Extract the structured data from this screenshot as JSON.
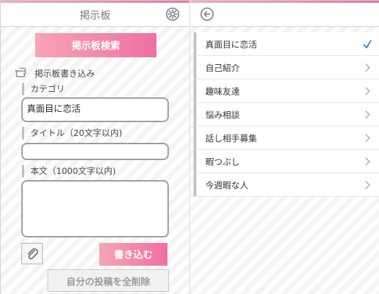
{
  "left": {
    "header": {
      "title": "掲示板",
      "settings_icon": "gear-icon"
    },
    "search_button": "掲示板検索",
    "section_title": "掲示板書き込み",
    "category": {
      "label": "カテゴリ",
      "value": "真面目に恋活"
    },
    "title_field": {
      "label": "タイトル（20文字以内)",
      "value": ""
    },
    "body_field": {
      "label": "本文（1000文字以内)",
      "value": ""
    },
    "attach_icon": "paperclip-icon",
    "write_button": "書き込む",
    "delete_button": "自分の投稿を全削除"
  },
  "right": {
    "header": {
      "back_icon": "back-arrow-icon"
    },
    "items": [
      {
        "label": "真面目に恋活",
        "selected": true
      },
      {
        "label": "自己紹介",
        "selected": false
      },
      {
        "label": "趣味友達",
        "selected": false
      },
      {
        "label": "悩み相談",
        "selected": false
      },
      {
        "label": "話し相手募集",
        "selected": false
      },
      {
        "label": "暇つぶし",
        "selected": false
      },
      {
        "label": "今週暇な人",
        "selected": false
      }
    ]
  },
  "colors": {
    "accent_start": "#f7a5b3",
    "accent_end": "#ee6fa5",
    "check": "#3a78c8"
  }
}
